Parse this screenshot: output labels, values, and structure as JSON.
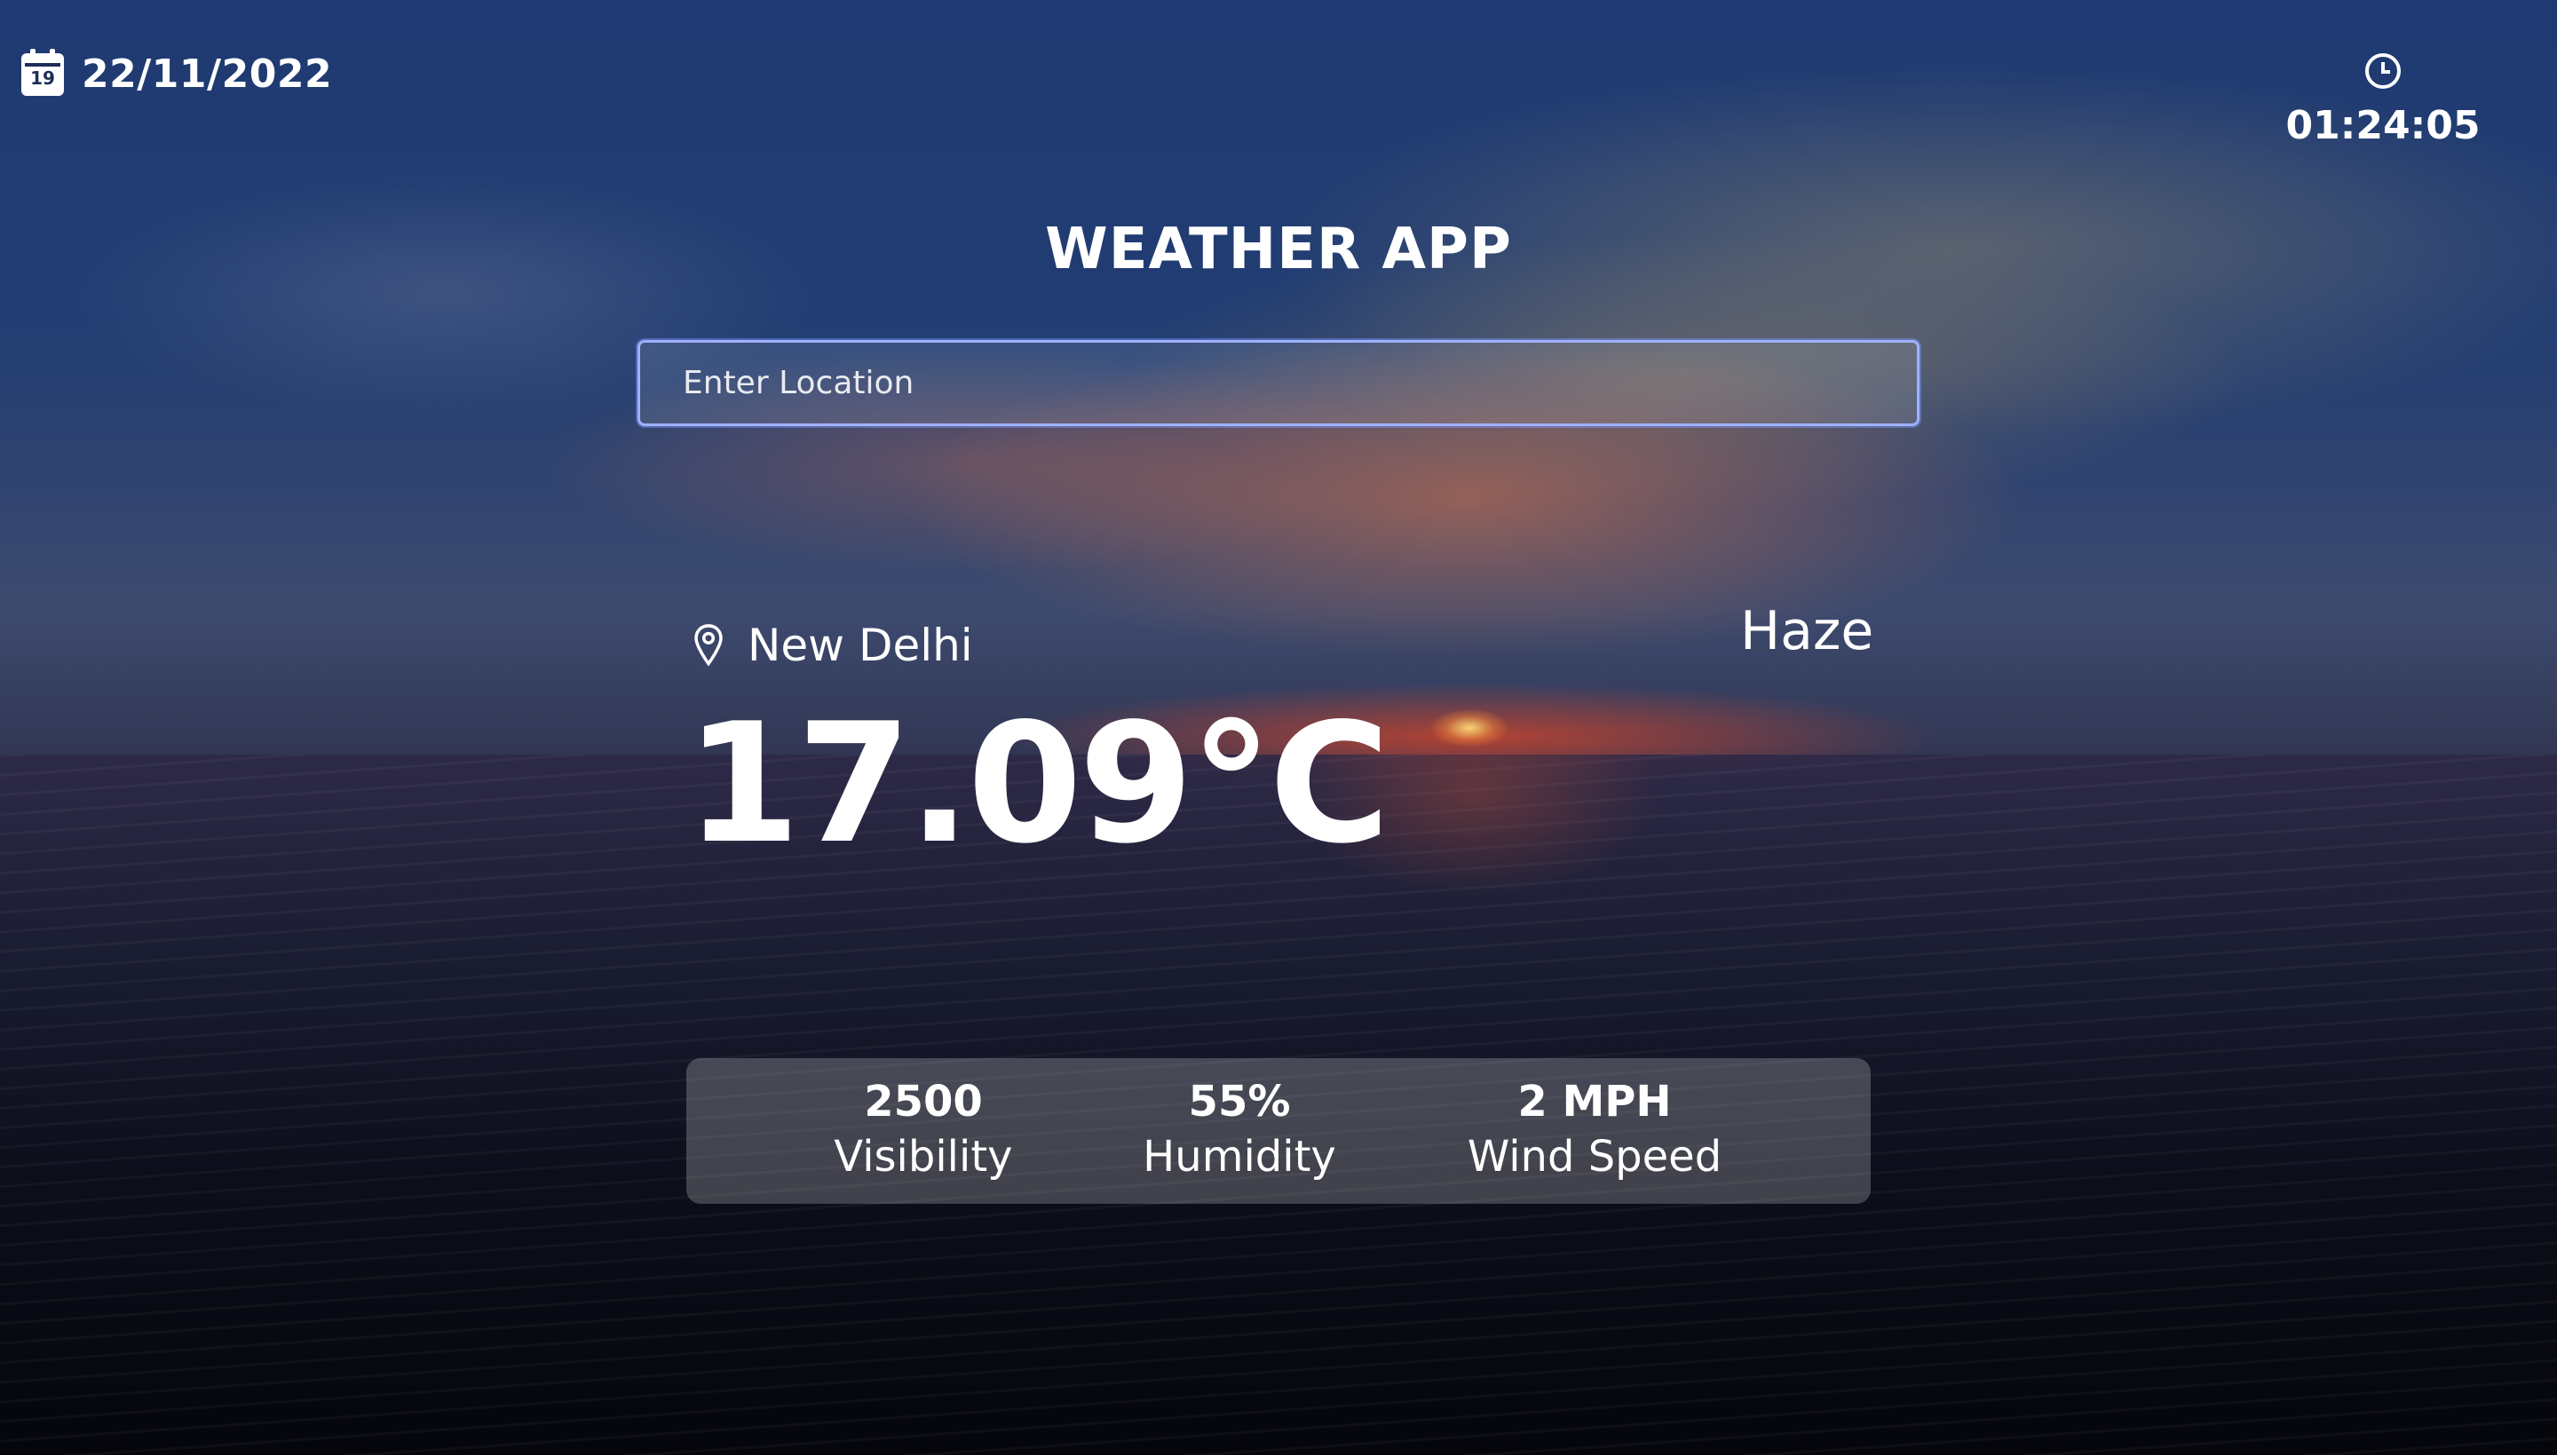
{
  "header": {
    "date": "22/11/2022",
    "calendar_icon_day": "19",
    "time": "01:24:05"
  },
  "app": {
    "title": "WEATHER APP"
  },
  "search": {
    "placeholder": "Enter Location",
    "value": ""
  },
  "weather": {
    "location": "New Delhi",
    "condition": "Haze",
    "temperature": "17.09°C"
  },
  "stats": [
    {
      "value": "2500",
      "label": "Visibility"
    },
    {
      "value": "55%",
      "label": "Humidity"
    },
    {
      "value": "2 MPH",
      "label": "Wind Speed"
    }
  ],
  "icons": {
    "calendar": "calendar-icon",
    "clock": "clock-icon",
    "location": "location-pin-icon"
  },
  "colors": {
    "text": "#ffffff",
    "input_border": "#9fb1ff",
    "panel_background": "rgba(255,255,255,0.22)"
  }
}
